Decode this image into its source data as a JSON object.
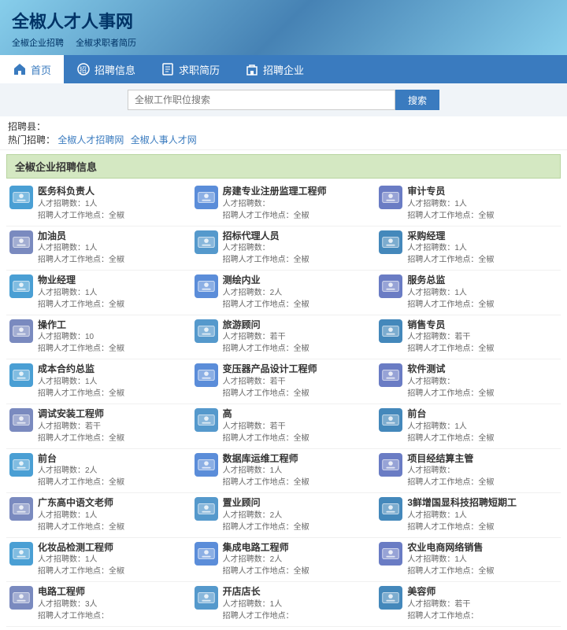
{
  "header": {
    "title": "全椒人才人事网",
    "subtitle_items": [
      "全椒企业招聘",
      "全椒求职者简历"
    ]
  },
  "nav": {
    "items": [
      {
        "label": "首页",
        "icon": "home",
        "active": true
      },
      {
        "label": "招聘信息",
        "icon": "megaphone",
        "active": false
      },
      {
        "label": "求职简历",
        "icon": "resume",
        "active": false
      },
      {
        "label": "招聘企业",
        "icon": "building",
        "active": false
      }
    ]
  },
  "search": {
    "placeholder": "全椒工作职位搜索",
    "button_label": "搜索"
  },
  "filter": {
    "label_county": "招聘县：",
    "label_hot": "热门招聘：",
    "hot_links": [
      "全椒人才招聘网",
      "全椒人事人才网"
    ]
  },
  "section_title": "全椒企业招聘信息",
  "jobs": [
    {
      "title": "医务科负责人",
      "count": "人才招聘数：1人",
      "location": "招聘人才工作地点：全椒"
    },
    {
      "title": "房建专业注册监理工程师",
      "count": "人才招聘数：",
      "location": "招聘人才工作地点：全椒"
    },
    {
      "title": "审计专员",
      "count": "人才招聘数：1人",
      "location": "招聘人才工作地点：全椒"
    },
    {
      "title": "加油员",
      "count": "人才招聘数：1人",
      "location": "招聘人才工作地点：全椒"
    },
    {
      "title": "招标代理人员",
      "count": "人才招聘数：",
      "location": "招聘人才工作地点：全椒"
    },
    {
      "title": "采购经理",
      "count": "人才招聘数：1人",
      "location": "招聘人才工作地点：全椒"
    },
    {
      "title": "物业经理",
      "count": "人才招聘数：1人",
      "location": "招聘人才工作地点：全椒"
    },
    {
      "title": "测绘内业",
      "count": "人才招聘数：2人",
      "location": "招聘人才工作地点：全椒"
    },
    {
      "title": "服务总监",
      "count": "人才招聘数：1人",
      "location": "招聘人才工作地点：全椒"
    },
    {
      "title": "操作工",
      "count": "人才招聘数：10",
      "location": "招聘人才工作地点：全椒"
    },
    {
      "title": "旅游顾问",
      "count": "人才招聘数：若干",
      "location": "招聘人才工作地点：全椒"
    },
    {
      "title": "销售专员",
      "count": "人才招聘数：若干",
      "location": "招聘人才工作地点：全椒"
    },
    {
      "title": "成本合约总监",
      "count": "人才招聘数：1人",
      "location": "招聘人才工作地点：全椒"
    },
    {
      "title": "变压器产品设计工程师",
      "count": "人才招聘数：若干",
      "location": "招聘人才工作地点：全椒"
    },
    {
      "title": "软件测试",
      "count": "人才招聘数：",
      "location": "招聘人才工作地点：全椒"
    },
    {
      "title": "调试安装工程师",
      "count": "人才招聘数：若干",
      "location": "招聘人才工作地点：全椒"
    },
    {
      "title": "高",
      "count": "人才招聘数：若干",
      "location": "招聘人才工作地点：全椒"
    },
    {
      "title": "前台",
      "count": "人才招聘数：1人",
      "location": "招聘人才工作地点：全椒"
    },
    {
      "title": "前台",
      "count": "人才招聘数：2人",
      "location": "招聘人才工作地点：全椒"
    },
    {
      "title": "数据库运维工程师",
      "count": "人才招聘数：1人",
      "location": "招聘人才工作地点：全椒"
    },
    {
      "title": "项目经结算主管",
      "count": "人才招聘数：",
      "location": "招聘人才工作地点：全椒"
    },
    {
      "title": "广东高中语文老师",
      "count": "人才招聘数：1人",
      "location": "招聘人才工作地点：全椒"
    },
    {
      "title": "置业顾问",
      "count": "人才招聘数：2人",
      "location": "招聘人才工作地点：全椒"
    },
    {
      "title": "3鲜增国显科技招聘短期工",
      "count": "人才招聘数：1人",
      "location": "招聘人才工作地点：全椒"
    },
    {
      "title": "化妆品检测工程师",
      "count": "人才招聘数：1人",
      "location": "招聘人才工作地点：全椒"
    },
    {
      "title": "集成电路工程师",
      "count": "人才招聘数：2人",
      "location": "招聘人才工作地点：全椒"
    },
    {
      "title": "农业电商网络销售",
      "count": "人才招聘数：1人",
      "location": "招聘人才工作地点：全椒"
    },
    {
      "title": "电路工程师",
      "count": "人才招聘数：3人",
      "location": "招聘人才工作地点："
    },
    {
      "title": "开店店长",
      "count": "人才招聘数：1人",
      "location": "招聘人才工作地点："
    },
    {
      "title": "美容师",
      "count": "人才招聘数：若干",
      "location": "招聘人才工作地点："
    }
  ]
}
